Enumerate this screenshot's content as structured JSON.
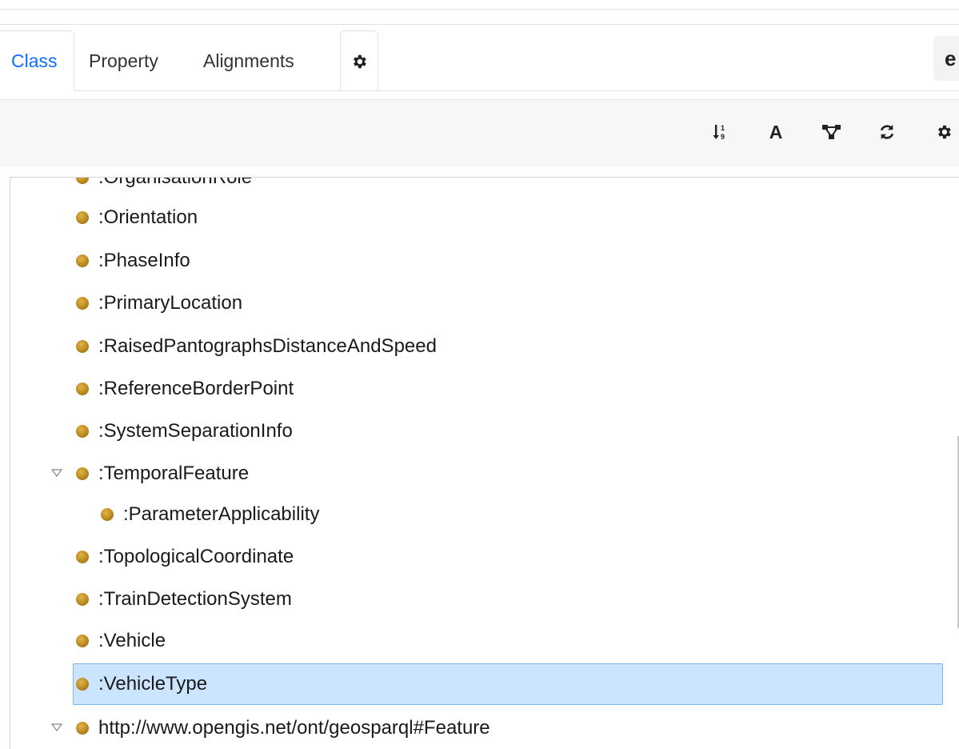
{
  "tabs": [
    {
      "label": "Class"
    },
    {
      "label": "Property"
    },
    {
      "label": "Alignments"
    }
  ],
  "tab_extra_glyph": "e",
  "toolbar": {
    "font_label": "A"
  },
  "tree": {
    "partial_top_label": ":OrganisationRole",
    "items": [
      ":Orientation",
      ":PhaseInfo",
      ":PrimaryLocation",
      ":RaisedPantographsDistanceAndSpeed",
      ":ReferenceBorderPoint",
      ":SystemSeparationInfo",
      ":TemporalFeature",
      ":ParameterApplicability",
      ":TopologicalCoordinate",
      ":TrainDetectionSystem",
      ":Vehicle",
      ":VehicleType",
      "http://www.opengis.net/ont/geosparql#Feature"
    ],
    "selected": ":VehicleType"
  },
  "colors": {
    "active_tab": "#0d6efd",
    "node_dot": "#c39224",
    "selection_bg": "#cce5ff",
    "selection_border": "#7fb6ea"
  }
}
